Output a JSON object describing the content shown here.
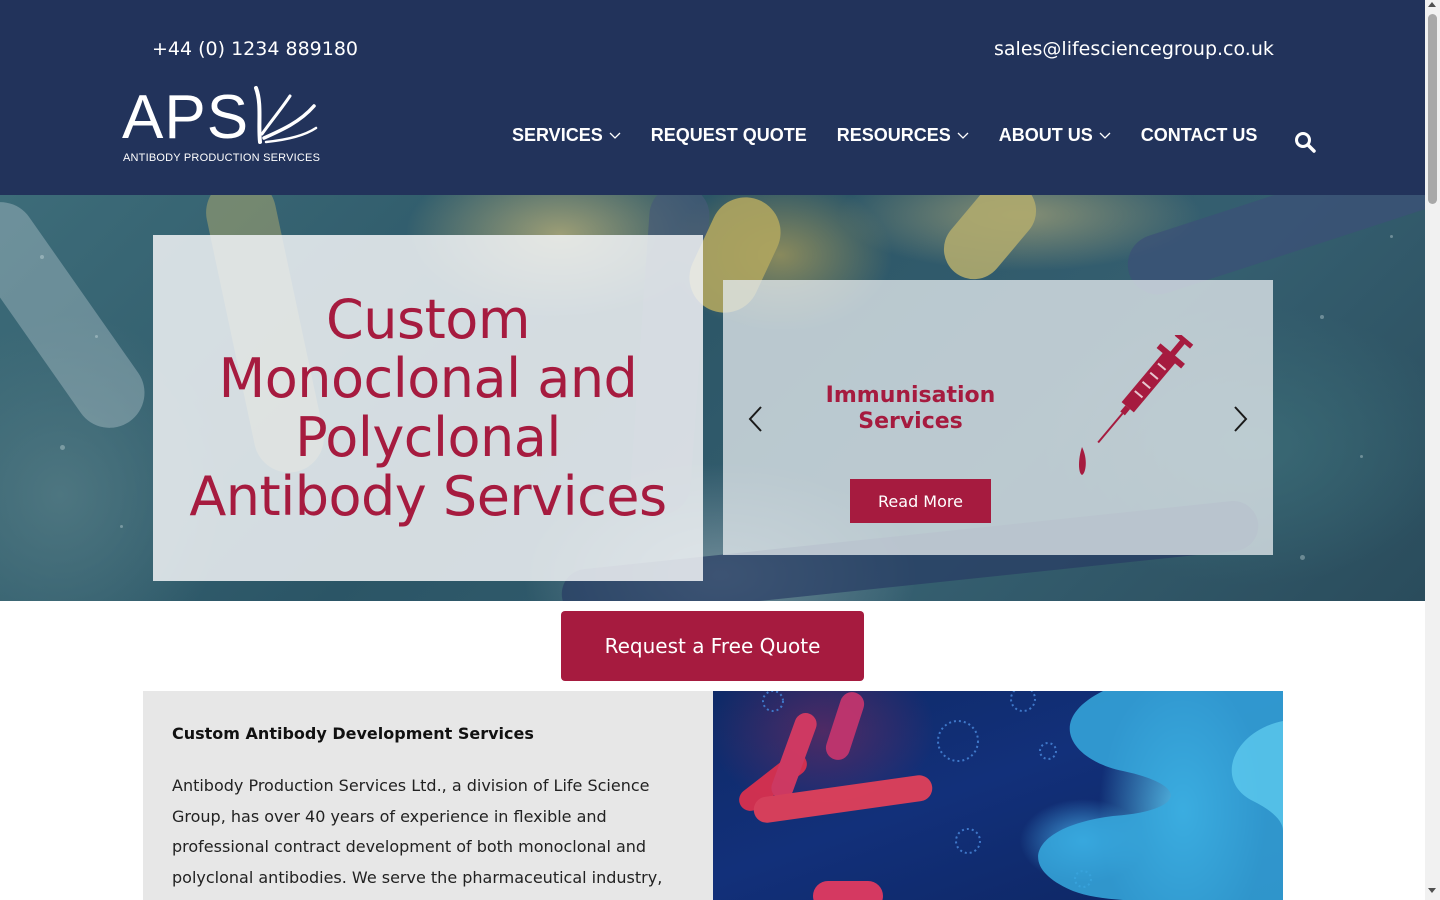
{
  "header": {
    "phone": "+44 (0) 1234 889180",
    "email": "sales@lifesciencegroup.co.uk",
    "logo": {
      "name": "APS",
      "tagline": "ANTIBODY PRODUCTION SERVICES"
    }
  },
  "nav": {
    "items": [
      {
        "label": "SERVICES",
        "has_dropdown": true
      },
      {
        "label": "REQUEST QUOTE",
        "has_dropdown": false
      },
      {
        "label": "RESOURCES",
        "has_dropdown": true
      },
      {
        "label": "ABOUT US",
        "has_dropdown": true
      },
      {
        "label": "CONTACT US",
        "has_dropdown": false
      }
    ],
    "search_icon": "search-icon"
  },
  "hero": {
    "title": "Custom Monoclonal and Polyclonal Antibody Services",
    "slide": {
      "title": "Immunisation Services",
      "button": "Read More",
      "icon": "syringe-icon",
      "prev_icon": "chevron-left-icon",
      "next_icon": "chevron-right-icon"
    }
  },
  "cta": {
    "label": "Request a Free Quote"
  },
  "content": {
    "heading": "Custom Antibody Development Services",
    "body": "Antibody Production Services Ltd., a division of Life Science Group, has over 40 years of experience in flexible and professional contract development of both monoclonal and polyclonal antibodies. We serve the pharmaceutical industry,"
  },
  "colors": {
    "header_bg": "#22335b",
    "accent": "#a61b3f",
    "content_bg": "#e7e7e7"
  }
}
